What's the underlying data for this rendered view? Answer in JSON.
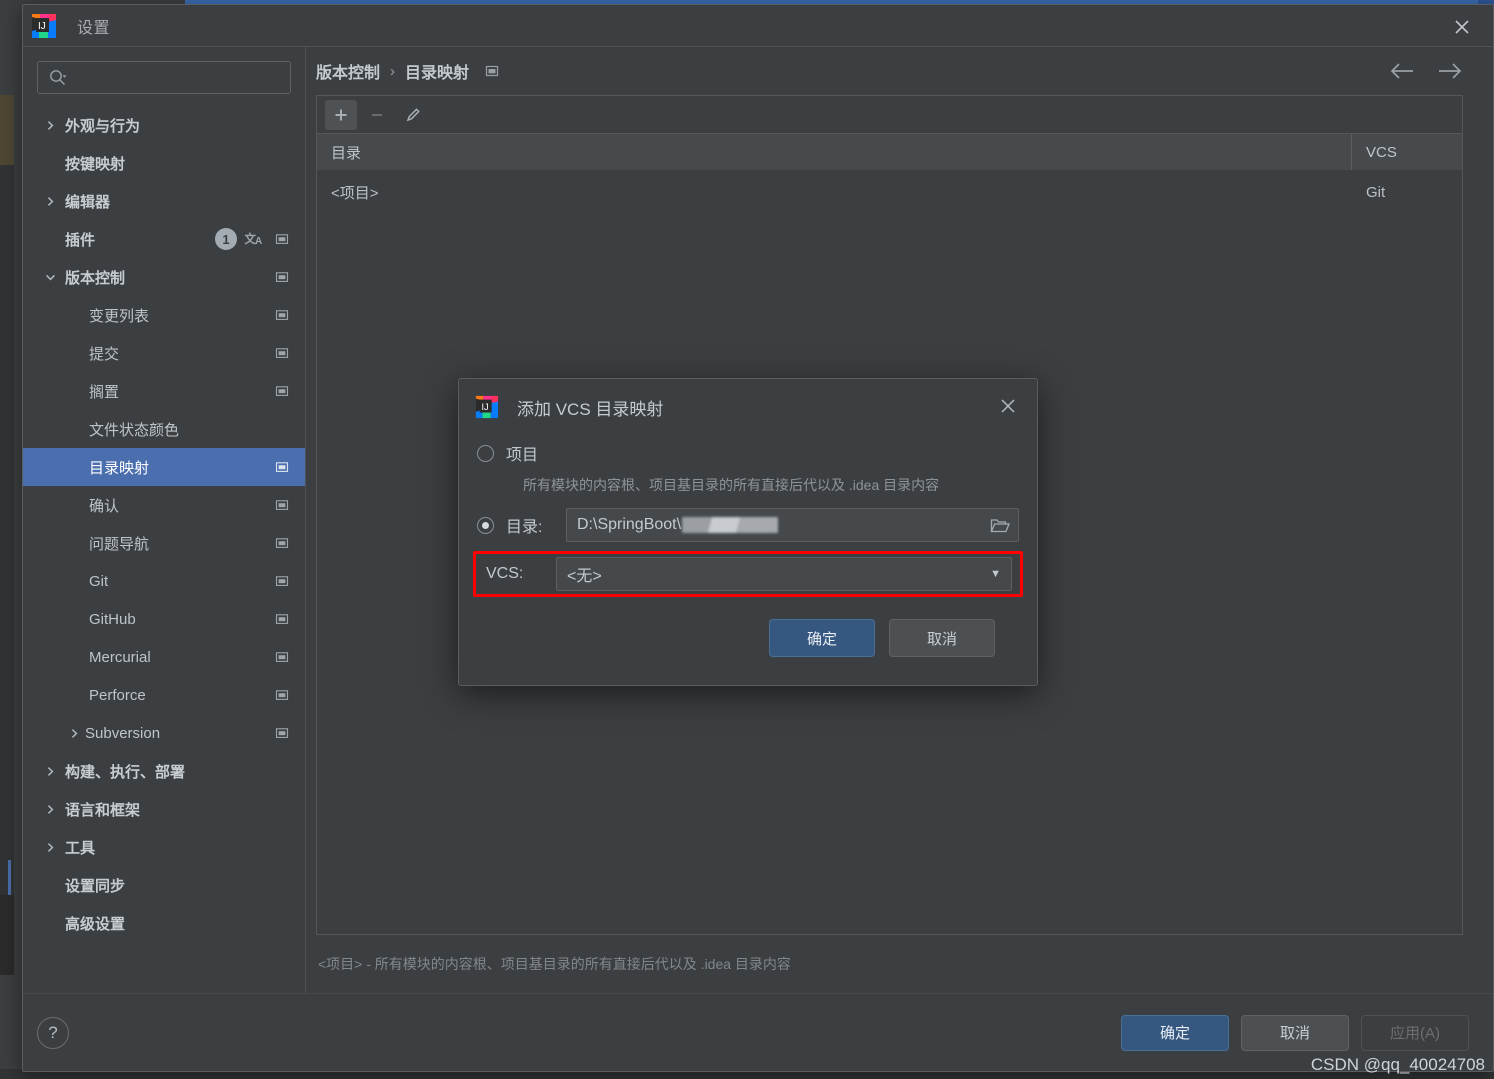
{
  "window": {
    "title": "设置",
    "logo_name": "intellij-idea-logo",
    "close_label": "×"
  },
  "sidebar": {
    "search": {
      "value": "",
      "placeholder": ""
    },
    "items": [
      {
        "label": "外观与行为",
        "level": 0,
        "arrow": "collapsed",
        "bold": true,
        "pin": false,
        "badge": "",
        "translate": false
      },
      {
        "label": "按键映射",
        "level": 0,
        "arrow": "none",
        "bold": true,
        "pin": false,
        "badge": "",
        "translate": false
      },
      {
        "label": "编辑器",
        "level": 0,
        "arrow": "collapsed",
        "bold": true,
        "pin": false,
        "badge": "",
        "translate": false
      },
      {
        "label": "插件",
        "level": 0,
        "arrow": "none",
        "bold": true,
        "pin": true,
        "badge": "1",
        "translate": true
      },
      {
        "label": "版本控制",
        "level": 0,
        "arrow": "expanded",
        "bold": true,
        "pin": true,
        "badge": "",
        "translate": false
      },
      {
        "label": "变更列表",
        "level": 1,
        "arrow": "none",
        "bold": false,
        "pin": true,
        "badge": "",
        "translate": false
      },
      {
        "label": "提交",
        "level": 1,
        "arrow": "none",
        "bold": false,
        "pin": true,
        "badge": "",
        "translate": false
      },
      {
        "label": "搁置",
        "level": 1,
        "arrow": "none",
        "bold": false,
        "pin": true,
        "badge": "",
        "translate": false
      },
      {
        "label": "文件状态颜色",
        "level": 1,
        "arrow": "none",
        "bold": false,
        "pin": false,
        "badge": "",
        "translate": false
      },
      {
        "label": "目录映射",
        "level": 1,
        "arrow": "none",
        "bold": false,
        "pin": true,
        "badge": "",
        "translate": false,
        "selected": true
      },
      {
        "label": "确认",
        "level": 1,
        "arrow": "none",
        "bold": false,
        "pin": true,
        "badge": "",
        "translate": false
      },
      {
        "label": "问题导航",
        "level": 1,
        "arrow": "none",
        "bold": false,
        "pin": true,
        "badge": "",
        "translate": false
      },
      {
        "label": "Git",
        "level": 1,
        "arrow": "none",
        "bold": false,
        "pin": true,
        "badge": "",
        "translate": false
      },
      {
        "label": "GitHub",
        "level": 1,
        "arrow": "none",
        "bold": false,
        "pin": true,
        "badge": "",
        "translate": false
      },
      {
        "label": "Mercurial",
        "level": 1,
        "arrow": "none",
        "bold": false,
        "pin": true,
        "badge": "",
        "translate": false
      },
      {
        "label": "Perforce",
        "level": 1,
        "arrow": "none",
        "bold": false,
        "pin": true,
        "badge": "",
        "translate": false
      },
      {
        "label": "Subversion",
        "level": 2,
        "arrow": "collapsed",
        "bold": false,
        "pin": true,
        "badge": "",
        "translate": false
      },
      {
        "label": "构建、执行、部署",
        "level": 0,
        "arrow": "collapsed",
        "bold": true,
        "pin": false,
        "badge": "",
        "translate": false
      },
      {
        "label": "语言和框架",
        "level": 0,
        "arrow": "collapsed",
        "bold": true,
        "pin": false,
        "badge": "",
        "translate": false
      },
      {
        "label": "工具",
        "level": 0,
        "arrow": "collapsed",
        "bold": true,
        "pin": false,
        "badge": "",
        "translate": false
      },
      {
        "label": "设置同步",
        "level": 0,
        "arrow": "none",
        "bold": true,
        "pin": false,
        "badge": "",
        "translate": false
      },
      {
        "label": "高级设置",
        "level": 0,
        "arrow": "none",
        "bold": true,
        "pin": false,
        "badge": "",
        "translate": false
      }
    ]
  },
  "main": {
    "breadcrumb": {
      "parent": "版本控制",
      "separator": "›",
      "current": "目录映射"
    },
    "nav": {
      "back": "←",
      "forward": "→"
    },
    "toolbar": {
      "add": "+",
      "remove": "−",
      "edit": "pencil-icon"
    },
    "table": {
      "columns": [
        "目录",
        "VCS"
      ],
      "rows": [
        {
          "directory": "<项目>",
          "vcs": "Git"
        }
      ]
    },
    "status": "<项目> - 所有模块的内容根、项目基目录的所有直接后代以及 .idea 目录内容"
  },
  "footer": {
    "help": "?",
    "ok": "确定",
    "cancel": "取消",
    "apply": "应用(A)"
  },
  "dialog": {
    "title": "添加 VCS 目录映射",
    "close_label": "×",
    "project_option": {
      "label": "项目",
      "selected": false
    },
    "project_hint": "所有模块的内容根、项目基目录的所有直接后代以及 .idea 目录内容",
    "directory_option": {
      "label": "目录:",
      "selected": true,
      "value": "D:\\SpringBoot\\"
    },
    "vcs_field": {
      "label": "VCS:",
      "value": "<无>"
    },
    "ok": "确定",
    "cancel": "取消"
  },
  "watermark": "CSDN @qq_40024708",
  "colors": {
    "accent_selection": "#4b6eaf",
    "primary_button": "#365880",
    "highlight_border": "#ff0000",
    "panel_bg": "#3c3f41"
  }
}
